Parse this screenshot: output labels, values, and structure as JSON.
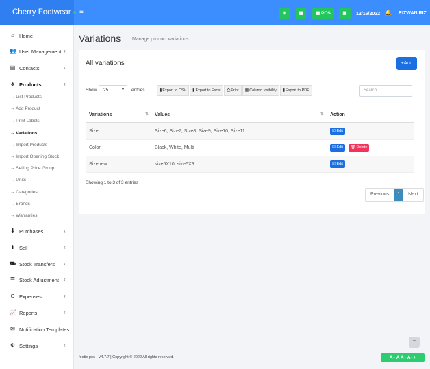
{
  "app": {
    "brand": "Cherry Footwear",
    "date": "12/16/2022",
    "user": "RIZWAN RIZ",
    "pos_label": "POS",
    "menu_icon": "hamburger-icon"
  },
  "sidebar": {
    "home": "Home",
    "user_management": "User Management",
    "contacts": "Contacts",
    "products": "Products",
    "products_sub": [
      "→ List Products",
      "→ Add Product",
      "→ Print Labels",
      "→ Variations",
      "→ Import Products",
      "→ Import Opening Stock",
      "→ Selling Price Group",
      "→ Units",
      "→ Categories",
      "→ Brands",
      "→ Warranties"
    ],
    "purchases": "Purchases",
    "sell": "Sell",
    "stock_transfers": "Stock Transfers",
    "stock_adjustment": "Stock Adjustment",
    "expenses": "Expenses",
    "reports": "Reports",
    "notification_templates": "Notification Templates",
    "settings": "Settings"
  },
  "page": {
    "title": "Variations",
    "subtitle": "Manage product variations"
  },
  "box": {
    "title": "All variations",
    "add_label": "+Add",
    "show_label": "Show",
    "page_length": "25",
    "entries_label": "entries",
    "search_placeholder": "Search ...",
    "exports": [
      "Export to CSV",
      "Export to Excel",
      "Print",
      "Column visibility",
      "Export to PDF"
    ]
  },
  "table": {
    "headers": [
      "Variations",
      "Values",
      "Action"
    ],
    "rows": [
      {
        "name": "Size",
        "values": "Size6, Size7, Size8, Size9, Size10, Size11"
      },
      {
        "name": "Color",
        "values": "Black, White, Multi"
      },
      {
        "name": "Sizenew",
        "values": "size5X10, size5X9"
      }
    ],
    "edit_label": "Edit",
    "delete_label": "Delete",
    "info": "Showing 1 to 3 of 3 entries",
    "pagination": {
      "previous": "Previous",
      "current": "1",
      "next": "Next"
    }
  },
  "footer": {
    "text": "footie pos - V4.7.7 | Copyright © 2022 All rights reserved.",
    "a11y": "A− A A+ A++"
  },
  "colors": {
    "topbar": "#3c8dfd",
    "primary_button": "#1b6fe0",
    "danger_button": "#f0345d",
    "success": "#22c55e"
  }
}
